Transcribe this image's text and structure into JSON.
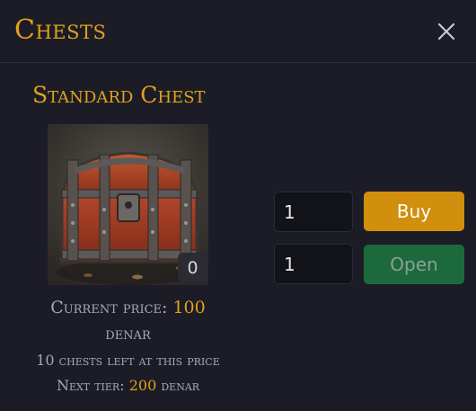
{
  "header": {
    "title": "Chests"
  },
  "chest": {
    "name": "Standard Chest",
    "owned_count": "0",
    "price_label": "Current price:",
    "price_value": "100",
    "currency": "denar",
    "remaining_text": "10 chests left at this price",
    "next_tier_label": "Next tier:",
    "next_tier_value": "200",
    "next_tier_currency": "denar"
  },
  "actions": {
    "buy_qty": "1",
    "buy_label": "Buy",
    "open_qty": "1",
    "open_label": "Open"
  },
  "colors": {
    "accent_gold": "#e0a11e",
    "buy_button": "#d08f0d",
    "open_button": "#1c6a3c",
    "background": "#1b1c25"
  },
  "icons": {
    "close": "close-icon"
  }
}
